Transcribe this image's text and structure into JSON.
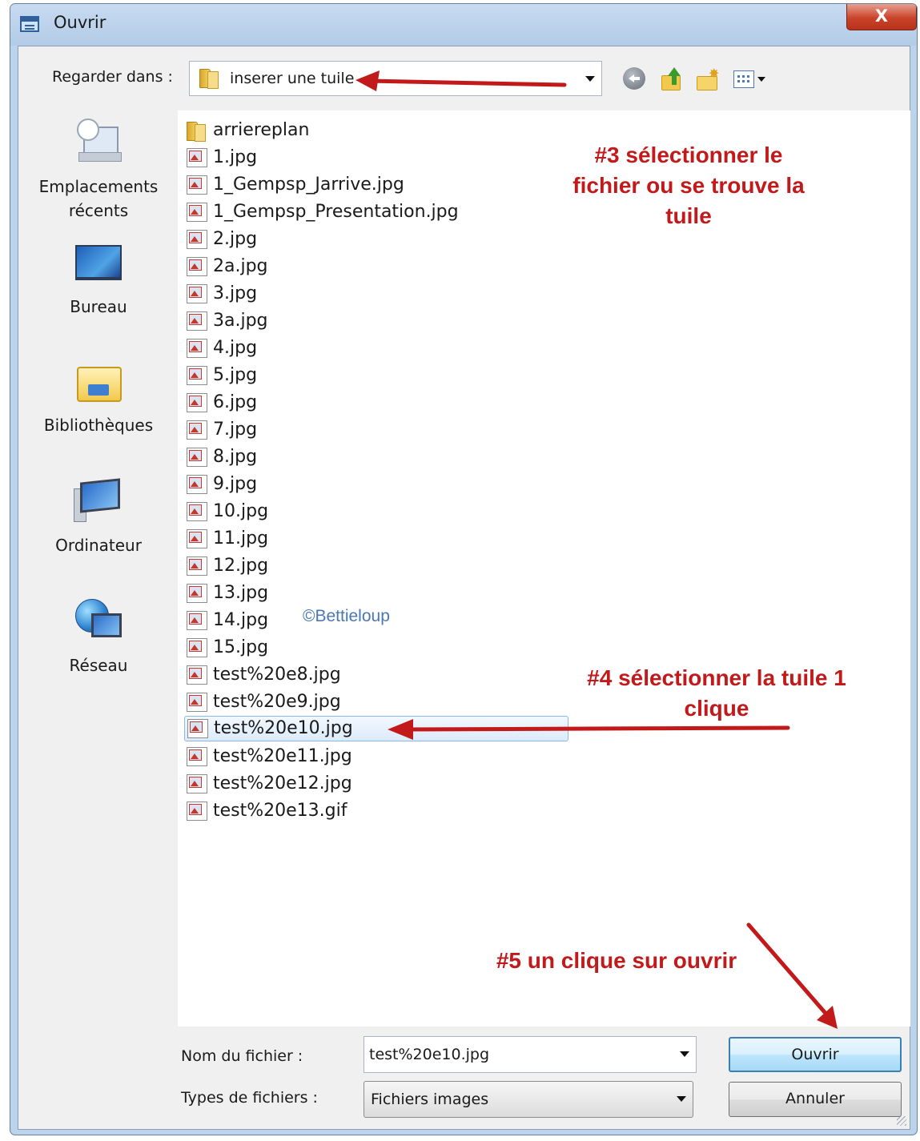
{
  "window": {
    "title": "Ouvrir",
    "close_glyph": "X"
  },
  "toolbar": {
    "look_in_label": "Regarder dans :",
    "look_in_value": "inserer une tuile",
    "icons": [
      "back-icon",
      "up-folder-icon",
      "new-folder-icon",
      "view-menu-icon"
    ]
  },
  "places": [
    {
      "label": "Emplacements récents",
      "icon": "recent-places-icon"
    },
    {
      "label": "Bureau",
      "icon": "desktop-icon"
    },
    {
      "label": "Bibliothèques",
      "icon": "libraries-icon"
    },
    {
      "label": "Ordinateur",
      "icon": "computer-icon"
    },
    {
      "label": "Réseau",
      "icon": "network-icon"
    }
  ],
  "files": [
    {
      "name": "arriereplan",
      "type": "folder"
    },
    {
      "name": "1.jpg",
      "type": "image"
    },
    {
      "name": "1_Gempsp_Jarrive.jpg",
      "type": "image"
    },
    {
      "name": "1_Gempsp_Presentation.jpg",
      "type": "image"
    },
    {
      "name": "2.jpg",
      "type": "image"
    },
    {
      "name": "2a.jpg",
      "type": "image"
    },
    {
      "name": "3.jpg",
      "type": "image"
    },
    {
      "name": "3a.jpg",
      "type": "image"
    },
    {
      "name": "4.jpg",
      "type": "image"
    },
    {
      "name": "5.jpg",
      "type": "image"
    },
    {
      "name": "6.jpg",
      "type": "image"
    },
    {
      "name": "7.jpg",
      "type": "image"
    },
    {
      "name": "8.jpg",
      "type": "image"
    },
    {
      "name": "9.jpg",
      "type": "image"
    },
    {
      "name": "10.jpg",
      "type": "image"
    },
    {
      "name": "11.jpg",
      "type": "image"
    },
    {
      "name": "12.jpg",
      "type": "image"
    },
    {
      "name": "13.jpg",
      "type": "image"
    },
    {
      "name": "14.jpg",
      "type": "image"
    },
    {
      "name": "15.jpg",
      "type": "image"
    },
    {
      "name": "test%20e8.jpg",
      "type": "image"
    },
    {
      "name": "test%20e9.jpg",
      "type": "image"
    },
    {
      "name": "test%20e10.jpg",
      "type": "image",
      "selected": true
    },
    {
      "name": "test%20e11.jpg",
      "type": "image"
    },
    {
      "name": "test%20e12.jpg",
      "type": "image"
    },
    {
      "name": "test%20e13.gif",
      "type": "image"
    }
  ],
  "watermark": "©Bettieloup",
  "annotations": {
    "step3": "#3 sélectionner le fichier ou se trouve la tuile",
    "step4": "#4 sélectionner la tuile 1 clique",
    "step5": "#5 un clique sur ouvrir",
    "arrow_color": "#c21a1a"
  },
  "footer": {
    "filename_label": "Nom du fichier :",
    "filename_value": "test%20e10.jpg",
    "filetype_label": "Types de fichiers :",
    "filetype_value": "Fichiers images",
    "open_button": "Ouvrir",
    "cancel_button": "Annuler"
  }
}
